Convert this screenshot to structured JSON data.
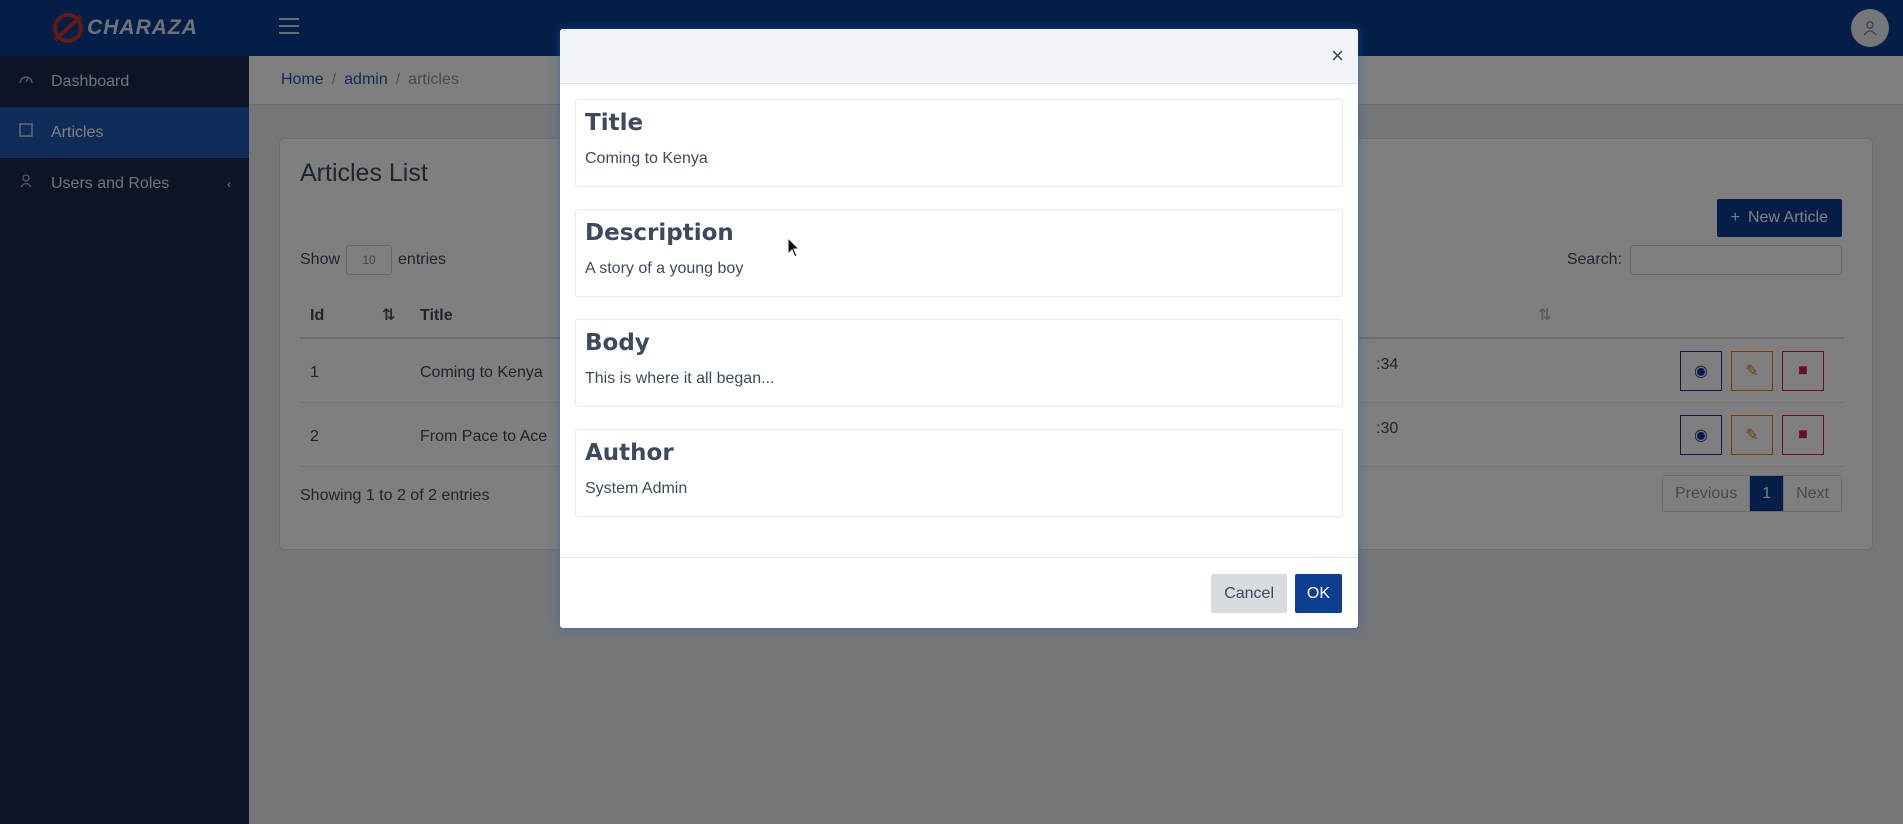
{
  "app": {
    "brand": "CHARAZA"
  },
  "sidebar": {
    "items": [
      {
        "label": "Dashboard",
        "icon": "speedometer-icon"
      },
      {
        "label": "Articles",
        "icon": "note-icon",
        "active": true
      },
      {
        "label": "Users and Roles",
        "icon": "user-icon",
        "has_submenu": true
      }
    ]
  },
  "topbar": {
    "menu_icon": "hamburger-icon",
    "avatar_icon": "user-avatar-icon"
  },
  "breadcrumb": {
    "home": "Home",
    "admin": "admin",
    "current": "articles"
  },
  "card": {
    "title": "Articles List",
    "new_button": "New Article",
    "show_label": "Show",
    "show_value": "10",
    "entries_label": "entries",
    "search_label": "Search:",
    "columns": [
      "Id",
      "Title"
    ],
    "rows": [
      {
        "id": "1",
        "title": "Coming to Kenya",
        "time_fragment": ":34"
      },
      {
        "id": "2",
        "title": "From Pace to Ace",
        "time_fragment": ":30"
      }
    ],
    "info": "Showing 1 to 2 of 2 entries",
    "pagination": {
      "previous": "Previous",
      "page": "1",
      "next": "Next"
    }
  },
  "modal": {
    "close": "×",
    "fields": [
      {
        "heading": "Title",
        "value": "Coming to Kenya"
      },
      {
        "heading": "Description",
        "value": "A story of a young boy"
      },
      {
        "heading": "Body",
        "value": "This is where it all began..."
      },
      {
        "heading": "Author",
        "value": "System Admin"
      }
    ],
    "cancel": "Cancel",
    "ok": "OK"
  },
  "colors": {
    "primary": "#0b3d91",
    "sidebar": "#172b4d",
    "edit": "#e07c14",
    "delete": "#d81b3c"
  }
}
